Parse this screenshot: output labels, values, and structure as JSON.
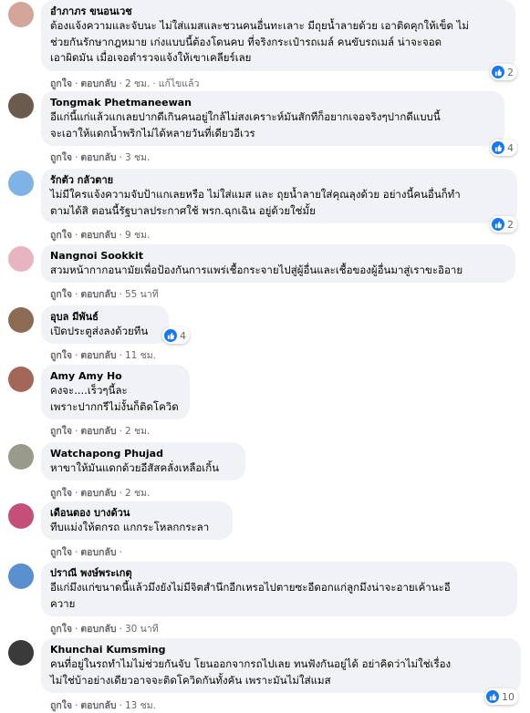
{
  "actions": {
    "like": "ถูกใจ",
    "reply": "ตอบกลับ",
    "edited": "แก้ไขแล้ว",
    "dot": "·"
  },
  "colors": {
    "bubble": "#f0f2f5",
    "like": "#1877f2",
    "meta": "#65676b"
  },
  "comments": [
    {
      "name": "อำภาภร ขนอนเวช",
      "text": "ต้องแจ้งความและจับนะ ไม่ใส่แมสและชวนคนอื่นทะเลาะ มีถุยน้ำลายด้วย เอาติดคุกให้เข็ด ไม่\nช่วยกันรักษากฎหมาย เก่งแบบนี้ต้องโดนคบ ที่จริงกระเป๋ารถเมล์ คนขับรถเมล์ น่าจะจอด\nเอาผิดมัน เมื่อเจอตำรวจแจ้งให้เขาเคลียร์เลย",
      "time": "2 ชม.",
      "edited": true,
      "reactions": "2",
      "avatar": "#d4a69a"
    },
    {
      "name": "Tongmak Phetmaneewan",
      "text": "อีแก่นี้แก่แล้วแกเลยปากดีเกินคนอยู่ใกล้ไม่สงเคราะห์มันสักทีก็อยากเจอจริงๆปากดีแบบนี้\nจะเอาให้แดกน้ำพริกไม่ได้หลายวันที่เดียวอีเวร",
      "time": "3 ชม.",
      "edited": false,
      "reactions": "4",
      "avatar": "#6b5a4e"
    },
    {
      "name": "รักตัว กลัวตาย",
      "text": "ไม่มีใครแจ้งความจับป้าแกเลยหรือ ไม่ใส่แมส และ ถุยน้ำลายใส่คุณลุงด้วย อย่างนี้คนอื่นก็ทำ\nตามได้สิ ตอนนี้รัฐบาลประกาศใช้ พรก.ฉุกเฉิน อยู่ด้วยใช่มั้ย",
      "time": "9 ชม.",
      "edited": false,
      "reactions": "2",
      "avatar": "#7fb2e5"
    },
    {
      "name": "Nangnoi Sookkit",
      "text": "สวมหน้ากากอนามัยเพื่อป้องกันการแพร่เชื้อกระจายไปสู่ผู้อื่นและเชื้อของผู้อื่นมาสู่เราขะอิอาย",
      "time": "55 นาที",
      "edited": false,
      "reactions": "",
      "avatar": "#e8b4c0"
    },
    {
      "name": "อุบล มีพันธ์",
      "text": "เปิดประตูส่งลงด้วยทีน",
      "time": "11 ชม.",
      "edited": false,
      "reactions": "4",
      "avatar": "#8c6b52"
    },
    {
      "name": "Amy Amy Ho",
      "text": "คงจะ....เร็วๆนี้ละ\nเพราะปากกรีไม่งั้นก็ติดโควิด",
      "time": "2 ชม.",
      "edited": false,
      "reactions": "",
      "avatar": "#a3675a"
    },
    {
      "name": "Watchapong Phujad",
      "text": "หาขาให้มันแดกด้วยอีสัสคลั่งเหลือเกิ้น",
      "time": "2 ชม.",
      "edited": false,
      "reactions": "",
      "avatar": "#9a9a8a"
    },
    {
      "name": "เดือนตอง บางด้วน",
      "text": "ทีบแม่งให้ตกรถ แกกระโหลกกระลา",
      "time": "",
      "edited": false,
      "reactions": "",
      "avatar": "#c4507a"
    },
    {
      "name": "ปราณี พงษ์พระเกตุ",
      "text": "อีแก่มึงแก่ขนาดนี้แล้วมึงยังไม่มีจิตสำนึกอีกเหรอไปตายซะอีดอกแก่ลูกมึงน่าจะอายเค้านะอี\nควาย",
      "time": "30 นาที",
      "edited": false,
      "reactions": "",
      "avatar": "#5a8fd0"
    },
    {
      "name": "Khunchai Kumsming",
      "text": "คนที่อยู่ในรถทำไมไม่ช่วยกันจับ โยนออกจากรถไปเลย ทนฟังกันอยู่ได้ อย่าคิดว่าไม่ใช่เรื่อง\nไม่ใช่บ้าอย่างเดียวอาจจะติดโควิดกันทั้งคัน เพราะมันไม่ใส่แมส",
      "time": "13 ชม.",
      "edited": false,
      "reactions": "10",
      "avatar": "#3a3a3a"
    }
  ]
}
